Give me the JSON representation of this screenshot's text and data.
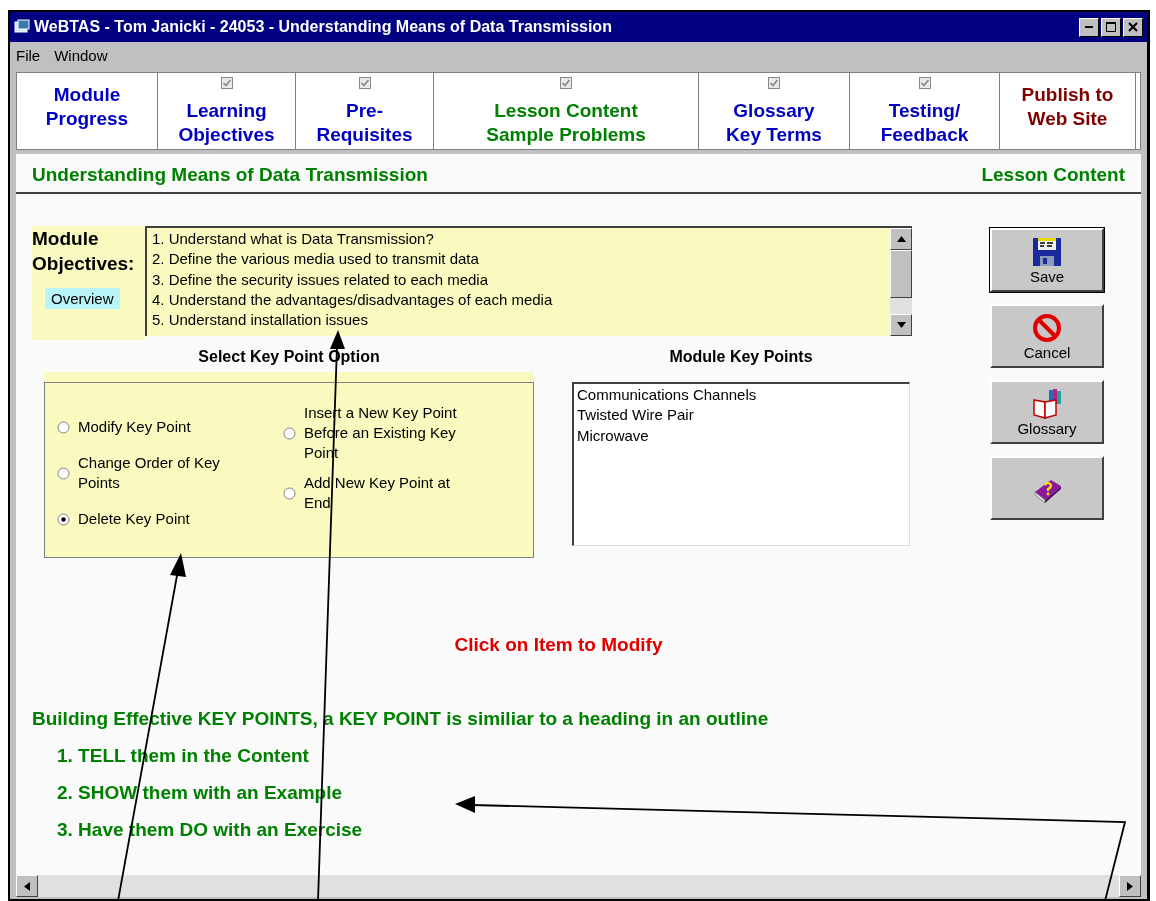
{
  "window": {
    "title": "WeBTAS - Tom Janicki - 24053 - Understanding Means of Data Transmission"
  },
  "menu": [
    "File",
    "Window"
  ],
  "tabs": [
    {
      "label": "Module\nProgress",
      "kind": "module",
      "selected": false
    },
    {
      "label": "Learning\nObjectives",
      "kind": "step",
      "checked": true,
      "selected": false
    },
    {
      "label": "Pre-\nRequisites",
      "kind": "step",
      "checked": true,
      "selected": false
    },
    {
      "label": "Lesson Content\nSample Problems",
      "kind": "step",
      "checked": true,
      "selected": true
    },
    {
      "label": "Glossary\nKey Terms",
      "kind": "step",
      "checked": true,
      "selected": false
    },
    {
      "label": "Testing/\nFeedback",
      "kind": "step",
      "checked": true,
      "selected": false
    },
    {
      "label": "Publish to\nWeb Site",
      "kind": "publish",
      "selected": false
    }
  ],
  "header": {
    "title": "Understanding Means of Data Transmission",
    "section": "Lesson Content"
  },
  "objectives": {
    "label": "Module\nObjectives:",
    "overview_button": "Overview",
    "items": [
      "1. Understand what is Data Transmission?",
      "2. Define the various media used to transmit data",
      "3. Define the security issues related to each media",
      "4. Understand the advantages/disadvantages of each media",
      "5. Understand installation issues"
    ]
  },
  "key_point_option": {
    "title": "Select Key Point Option",
    "left_options": [
      {
        "label": "Modify Key Point",
        "selected": false
      },
      {
        "label": "Change Order of Key Points",
        "selected": false
      },
      {
        "label": "Delete Key Point",
        "selected": true
      }
    ],
    "right_options": [
      {
        "label": "Insert a New Key Point Before an Existing Key Point",
        "selected": false
      },
      {
        "label": "Add New Key Point at End",
        "selected": false
      }
    ]
  },
  "module_key_points": {
    "title": "Module Key Points",
    "items": [
      "Communications Channels",
      "Twisted Wire Pair",
      "Microwave"
    ]
  },
  "buttons": [
    {
      "kind": "save",
      "label": "Save"
    },
    {
      "kind": "cancel",
      "label": "Cancel"
    },
    {
      "kind": "glossary",
      "label": "Glossary"
    },
    {
      "kind": "help"
    }
  ],
  "prompt": "Click on Item to Modify",
  "guidance": {
    "heading": "Building Effective KEY POINTS, a KEY POINT is similiar to a heading in an outline",
    "steps": [
      "1. TELL them in the Content",
      "2. SHOW them with an Example",
      "3. Have them DO with an Exercise"
    ]
  }
}
